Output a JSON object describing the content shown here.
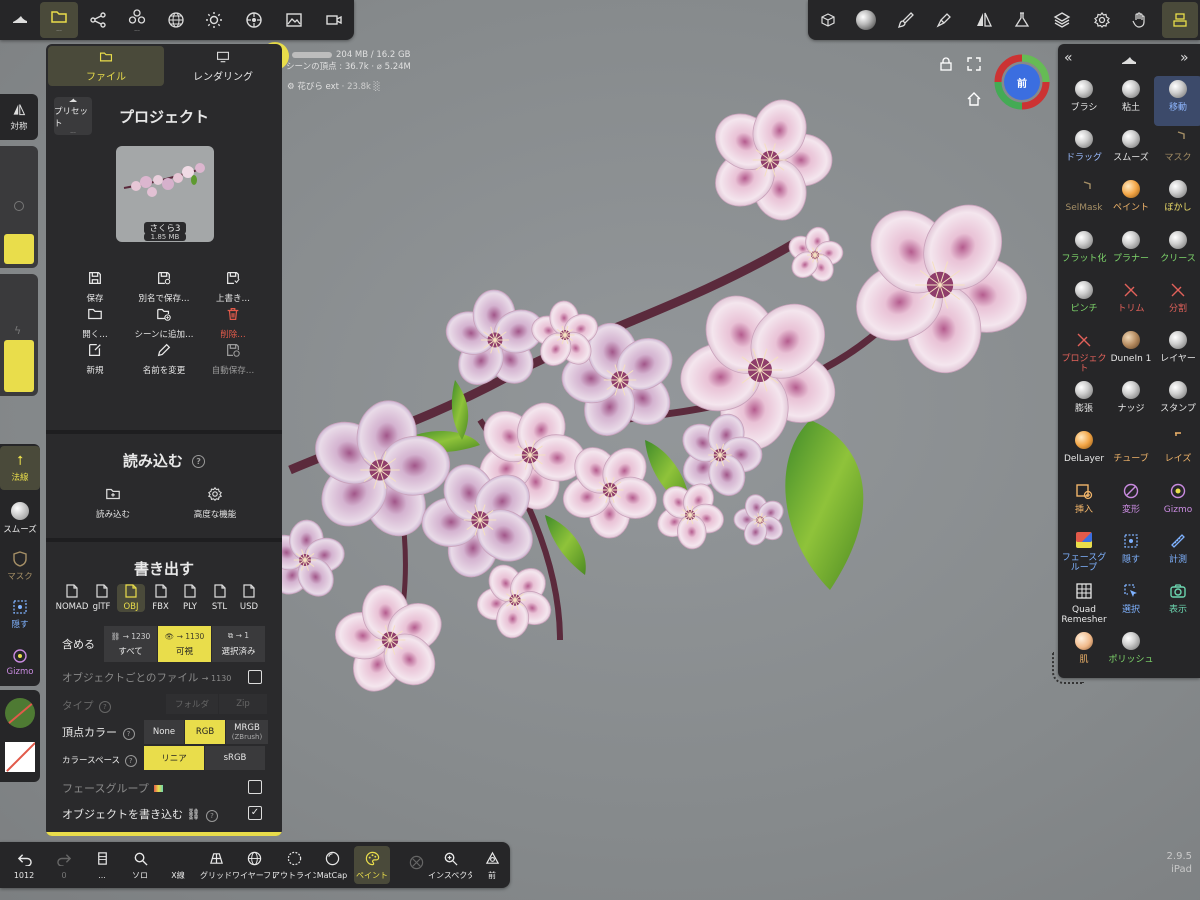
{
  "stats": {
    "memory": "204 MB / 16.2 GB",
    "scene_vertices": "シーンの頂点 : 36.7k · ⌀ 5.24M",
    "selected_object": "花びら ext",
    "selected_object_verts": "23.8k"
  },
  "version": {
    "number": "2.9.5",
    "device": "iPad"
  },
  "gizmo": {
    "face_label": "前"
  },
  "panel": {
    "tabs": [
      {
        "label": "ファイル",
        "active": true
      },
      {
        "label": "レンダリング",
        "active": false
      }
    ],
    "preset_label": "プリセット",
    "project_title": "プロジェクト",
    "thumbnail": {
      "name": "さくら3",
      "size": "1.85 MB"
    },
    "file_actions": [
      {
        "label": "保存",
        "icon": "save-icon",
        "color": "#e8e8e8"
      },
      {
        "label": "別名で保存…",
        "icon": "save-as-icon",
        "color": "#e8e8e8"
      },
      {
        "label": "上書き…",
        "icon": "overwrite-icon",
        "color": "#e8e8e8"
      },
      {
        "label": "開く…",
        "icon": "folder-open-icon",
        "color": "#e8e8e8"
      },
      {
        "label": "シーンに追加…",
        "icon": "add-to-scene-icon",
        "color": "#e8e8e8"
      },
      {
        "label": "削除…",
        "icon": "trash-icon",
        "color": "#e25a4a"
      },
      {
        "label": "新規",
        "icon": "new-file-icon",
        "color": "#e8e8e8"
      },
      {
        "label": "名前を変更",
        "icon": "pencil-icon",
        "color": "#e8e8e8"
      },
      {
        "label": "自動保存…",
        "icon": "autosave-icon",
        "color": "#9a9a9a"
      }
    ],
    "import_title": "読み込む",
    "import_actions": [
      {
        "label": "読み込む"
      },
      {
        "label": "高度な機能"
      }
    ],
    "export_title": "書き出す",
    "formats": [
      "NOMAD",
      "glTF",
      "OBJ",
      "FBX",
      "PLY",
      "STL",
      "USD"
    ],
    "active_format": "OBJ",
    "include_label": "含める",
    "include_options": [
      {
        "count": "→ 1230",
        "label": "すべて",
        "active": false
      },
      {
        "count": "→ 1130",
        "label": "可視",
        "active": true
      },
      {
        "count": "→ 1",
        "label": "選択済み",
        "active": false
      }
    ],
    "per_object_label": "オブジェクトごとのファイル",
    "per_object_count": "→ 1130",
    "type_label": "タイプ",
    "type_options": [
      "フォルダ",
      "Zip"
    ],
    "vertex_color_label": "頂点カラー",
    "vertex_color_options": [
      {
        "label": "None",
        "active": false
      },
      {
        "label": "RGB",
        "active": true
      },
      {
        "label": "MRGB",
        "sub": "(ZBrush)",
        "active": false
      }
    ],
    "color_space_label": "カラースペース",
    "color_space_options": [
      {
        "label": "リニア",
        "active": true
      },
      {
        "label": "sRGB",
        "active": false
      }
    ],
    "face_group_label": "フェースグループ",
    "write_objects_label": "オブジェクトを書き込む",
    "write_objects_checked": true
  },
  "left_side": {
    "symmetry": "対称",
    "normal": "法線",
    "smooth": "スムーズ",
    "mask": "マスク",
    "hide": "隠す",
    "gizmo": "Gizmo"
  },
  "tools": [
    {
      "label": "ブラシ",
      "color": "#e8e8e8",
      "kind": "ball"
    },
    {
      "label": "粘土",
      "color": "#e8e8e8",
      "kind": "ball"
    },
    {
      "label": "移動",
      "color": "#8fb7ff",
      "kind": "ball",
      "active": true
    },
    {
      "label": "ドラッグ",
      "color": "#9bbcff",
      "kind": "ball"
    },
    {
      "label": "スムーズ",
      "color": "#e8e8e8",
      "kind": "ball"
    },
    {
      "label": "マスク",
      "color": "#a58f66",
      "kind": "mask"
    },
    {
      "label": "SelMask",
      "color": "#a58f66",
      "kind": "mask"
    },
    {
      "label": "ペイント",
      "color": "#f0b46a",
      "kind": "orange"
    },
    {
      "label": "ぼかし",
      "color": "#f0e06a",
      "kind": "ball"
    },
    {
      "label": "フラット化",
      "color": "#7ed76b",
      "kind": "ball"
    },
    {
      "label": "プラナー",
      "color": "#7ed76b",
      "kind": "ball"
    },
    {
      "label": "クリース",
      "color": "#7ed76b",
      "kind": "ball"
    },
    {
      "label": "ピンチ",
      "color": "#7ed76b",
      "kind": "ball"
    },
    {
      "label": "トリム",
      "color": "#e2615a",
      "kind": "trim"
    },
    {
      "label": "分割",
      "color": "#e2615a",
      "kind": "trim"
    },
    {
      "label": "プロジェクト",
      "color": "#e2615a",
      "kind": "trim"
    },
    {
      "label": "DuneIn 1",
      "color": "#e8e8e8",
      "kind": "tan"
    },
    {
      "label": "レイヤー",
      "color": "#e8e8e8",
      "kind": "ball"
    },
    {
      "label": "膨張",
      "color": "#e8e8e8",
      "kind": "ball"
    },
    {
      "label": "ナッジ",
      "color": "#e8e8e8",
      "kind": "ball"
    },
    {
      "label": "スタンプ",
      "color": "#e8e8e8",
      "kind": "ball"
    },
    {
      "label": "DelLayer",
      "color": "#e8e8e8",
      "kind": "orange"
    },
    {
      "label": "チューブ",
      "color": "#f0b46a",
      "kind": "tube"
    },
    {
      "label": "レイズ",
      "color": "#f0b46a",
      "kind": "vase"
    },
    {
      "label": "挿入",
      "color": "#f0b46a",
      "kind": "insert"
    },
    {
      "label": "変形",
      "color": "#c98be0",
      "kind": "deform"
    },
    {
      "label": "Gizmo",
      "color": "#c98be0",
      "kind": "gizmo"
    },
    {
      "label": "フェースグループ",
      "color": "#7fb2ff",
      "kind": "facegroup"
    },
    {
      "label": "隠す",
      "color": "#7fb2ff",
      "kind": "hide"
    },
    {
      "label": "計測",
      "color": "#7fb2ff",
      "kind": "ruler"
    },
    {
      "label": "Quad Remesher",
      "color": "#e8e8e8",
      "kind": "grid"
    },
    {
      "label": "選択",
      "color": "#7fb2ff",
      "kind": "select"
    },
    {
      "label": "表示",
      "color": "#6cd6b0",
      "kind": "camera"
    },
    {
      "label": "肌",
      "color": "#f0b46a",
      "kind": "skin"
    },
    {
      "label": "ポリッシュ",
      "color": "#7ed76b",
      "kind": "ball"
    }
  ],
  "bottom": [
    {
      "label": "1012",
      "icon": "undo-icon"
    },
    {
      "label": "0",
      "icon": "redo-icon"
    },
    {
      "label": "...",
      "icon": "menu-icon"
    },
    {
      "label": "ソロ",
      "icon": "solo-icon"
    },
    {
      "label": "X線",
      "icon": "xray-icon"
    },
    {
      "label": "グリッド",
      "icon": "grid-icon"
    },
    {
      "label": "ワイヤーフレーム",
      "icon": "wireframe-icon"
    },
    {
      "label": "アウトライン",
      "icon": "outline-icon"
    },
    {
      "label": "MatCap",
      "icon": "matcap-icon"
    },
    {
      "label": "ペイント",
      "icon": "palette-icon",
      "active": true
    },
    {
      "label": "",
      "icon": "disabled-icon"
    },
    {
      "label": "インスペクタ",
      "icon": "inspector-icon"
    },
    {
      "label": "前",
      "icon": "front-view-icon"
    }
  ],
  "colors": {
    "accent": "#e9dd4b",
    "panel": "#2a2a2c",
    "bar": "#262628",
    "viewport": "#8a8d8e"
  }
}
